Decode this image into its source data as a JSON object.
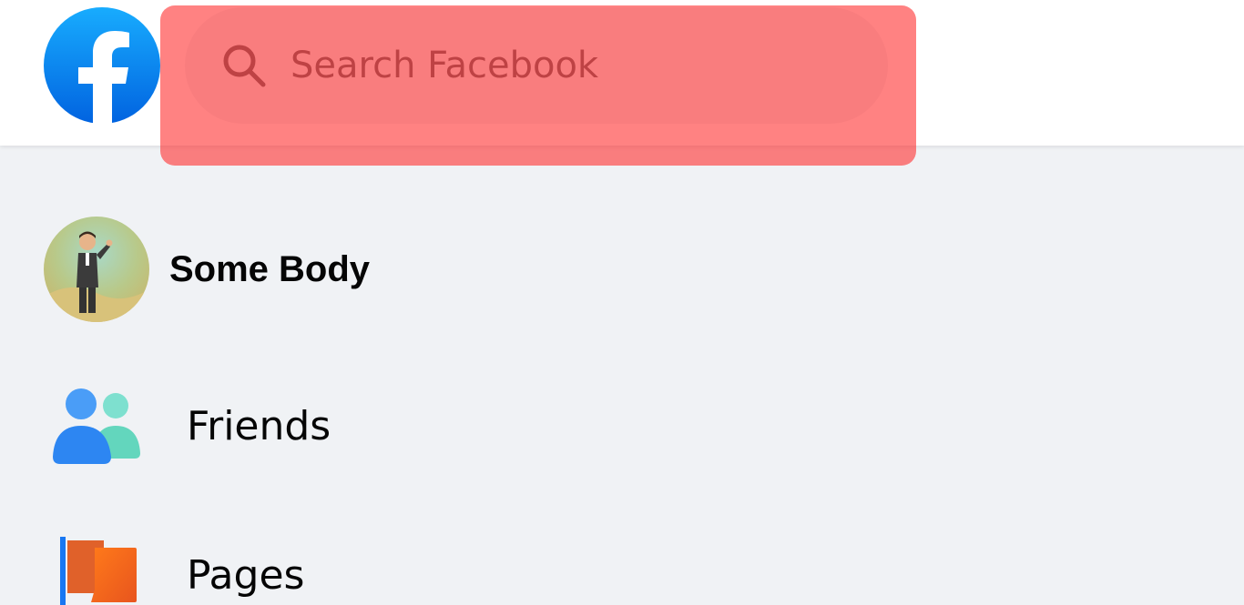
{
  "header": {
    "logo_icon": "facebook-logo-icon",
    "search": {
      "icon": "search-icon",
      "placeholder": "Search Facebook",
      "value": ""
    },
    "highlight_color": "#ff2828"
  },
  "sidebar": {
    "profile": {
      "name": "Some Body",
      "avatar_icon": "avatar"
    },
    "items": [
      {
        "label": "Friends",
        "icon": "friends-icon"
      },
      {
        "label": "Pages",
        "icon": "pages-flag-icon"
      }
    ]
  },
  "colors": {
    "brand": "#1877f2",
    "background": "#f0f2f5",
    "text": "#050505",
    "muted": "#65676b"
  }
}
